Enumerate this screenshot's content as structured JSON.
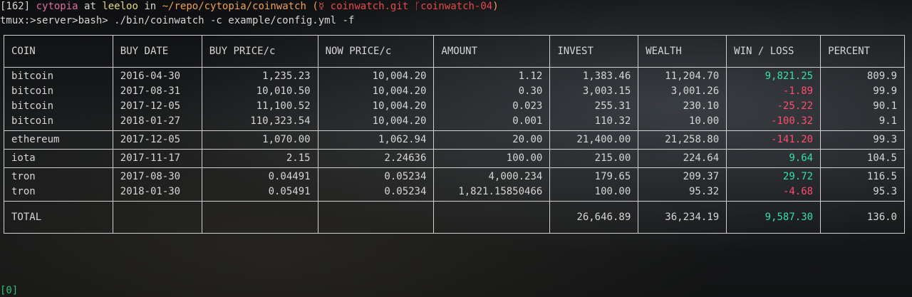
{
  "prompt": {
    "history_num": "[162]",
    "user": "cytopia",
    "at": " at ",
    "host": "leeloo",
    "in": " in ",
    "path": "~/repo/cytopia/coinwatch",
    "git_open": " (",
    "git_icon": "☿",
    "git_repo": " coinwatch.git",
    "branch_sep": " ᚴ",
    "branch": "coinwatch-04",
    "git_close": ")"
  },
  "command": {
    "context": "tmux:>server>bash>",
    "text": " ./bin/coinwatch -c example/config.yml -f"
  },
  "table": {
    "headers": [
      "COIN",
      "BUY DATE",
      "BUY PRICE/c",
      "NOW PRICE/c",
      "AMOUNT",
      "INVEST",
      "WEALTH",
      "WIN / LOSS",
      "PERCENT"
    ],
    "groups": [
      {
        "coin": [
          "bitcoin",
          "bitcoin",
          "bitcoin",
          "bitcoin"
        ],
        "buy_date": [
          "2016-04-30",
          "2017-08-31",
          "2017-12-05",
          "2018-01-27"
        ],
        "buy_price": [
          "1,235.23",
          "10,010.50",
          "11,100.52",
          "110,323.54"
        ],
        "now_price": [
          "10,004.20",
          "10,004.20",
          "10,004.20",
          "10,004.20"
        ],
        "amount": [
          "1.12",
          "0.30",
          "0.023",
          "0.001"
        ],
        "invest": [
          "1,383.46",
          "3,003.15",
          "255.31",
          "110.32"
        ],
        "wealth": [
          "11,204.70",
          "3,001.26",
          "230.10",
          "10.00"
        ],
        "winloss": [
          "9,821.25",
          "-1.89",
          "-25.22",
          "-100.32"
        ],
        "percent": [
          "809.9",
          "99.9",
          "90.1",
          "9.1"
        ]
      },
      {
        "coin": [
          "ethereum"
        ],
        "buy_date": [
          "2017-12-05"
        ],
        "buy_price": [
          "1,070.00"
        ],
        "now_price": [
          "1,062.94"
        ],
        "amount": [
          "20.00"
        ],
        "invest": [
          "21,400.00"
        ],
        "wealth": [
          "21,258.80"
        ],
        "winloss": [
          "-141.20"
        ],
        "percent": [
          "99.3"
        ]
      },
      {
        "coin": [
          "iota"
        ],
        "buy_date": [
          "2017-11-17"
        ],
        "buy_price": [
          "2.15"
        ],
        "now_price": [
          "2.24636"
        ],
        "amount": [
          "100.00"
        ],
        "invest": [
          "215.00"
        ],
        "wealth": [
          "224.64"
        ],
        "winloss": [
          "9.64"
        ],
        "percent": [
          "104.5"
        ]
      },
      {
        "coin": [
          "tron",
          "tron"
        ],
        "buy_date": [
          "2017-08-30",
          "2018-01-30"
        ],
        "buy_price": [
          "0.04491",
          "0.05491"
        ],
        "now_price": [
          "0.05234",
          "0.05234"
        ],
        "amount": [
          "4,000.234",
          "1,821.15850466"
        ],
        "invest": [
          "179.65",
          "100.00"
        ],
        "wealth": [
          "209.37",
          "95.32"
        ],
        "winloss": [
          "29.72",
          "-4.68"
        ],
        "percent": [
          "116.5",
          "95.3"
        ]
      }
    ],
    "total": {
      "label": "TOTAL",
      "invest": "26,646.89",
      "wealth": "36,234.19",
      "winloss": "9,587.30",
      "percent": "136.0"
    }
  },
  "tmux_window": "[0]",
  "colors": {
    "positive": "#35e0a5",
    "negative": "#ff4d6d"
  }
}
